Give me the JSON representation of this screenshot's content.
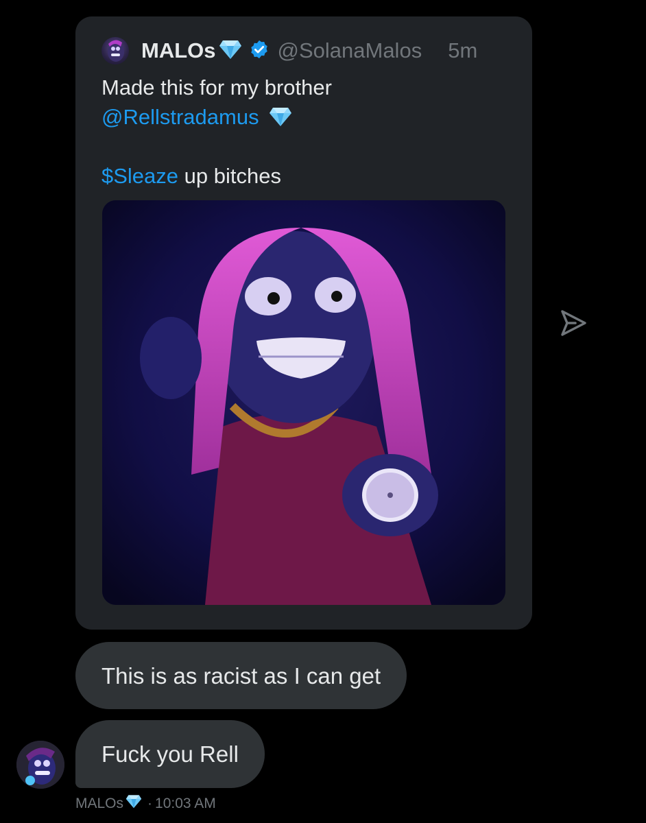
{
  "quoted_post": {
    "author_name": "MALOs",
    "author_handle": "@SolanaMalos",
    "age": "5m",
    "text_line1": "Made this for my brother",
    "mention": "@Rellstradamus",
    "cashtag": "$Sleaze",
    "text_line3_rest": " up bitches",
    "icons": [
      "diamond-emoji-icon",
      "verified-badge-icon"
    ]
  },
  "messages": [
    {
      "text": "This is as racist as I can get"
    },
    {
      "text": "Fuck you Rell"
    }
  ],
  "meta": {
    "sender_name": "MALOs",
    "time": "10:03 AM",
    "separator": "·"
  },
  "colors": {
    "background": "#000000",
    "card": "#202327",
    "bubble": "#2f3336",
    "link": "#1d9bf0",
    "muted": "#71767b",
    "diamond": "#4fc3f7"
  }
}
